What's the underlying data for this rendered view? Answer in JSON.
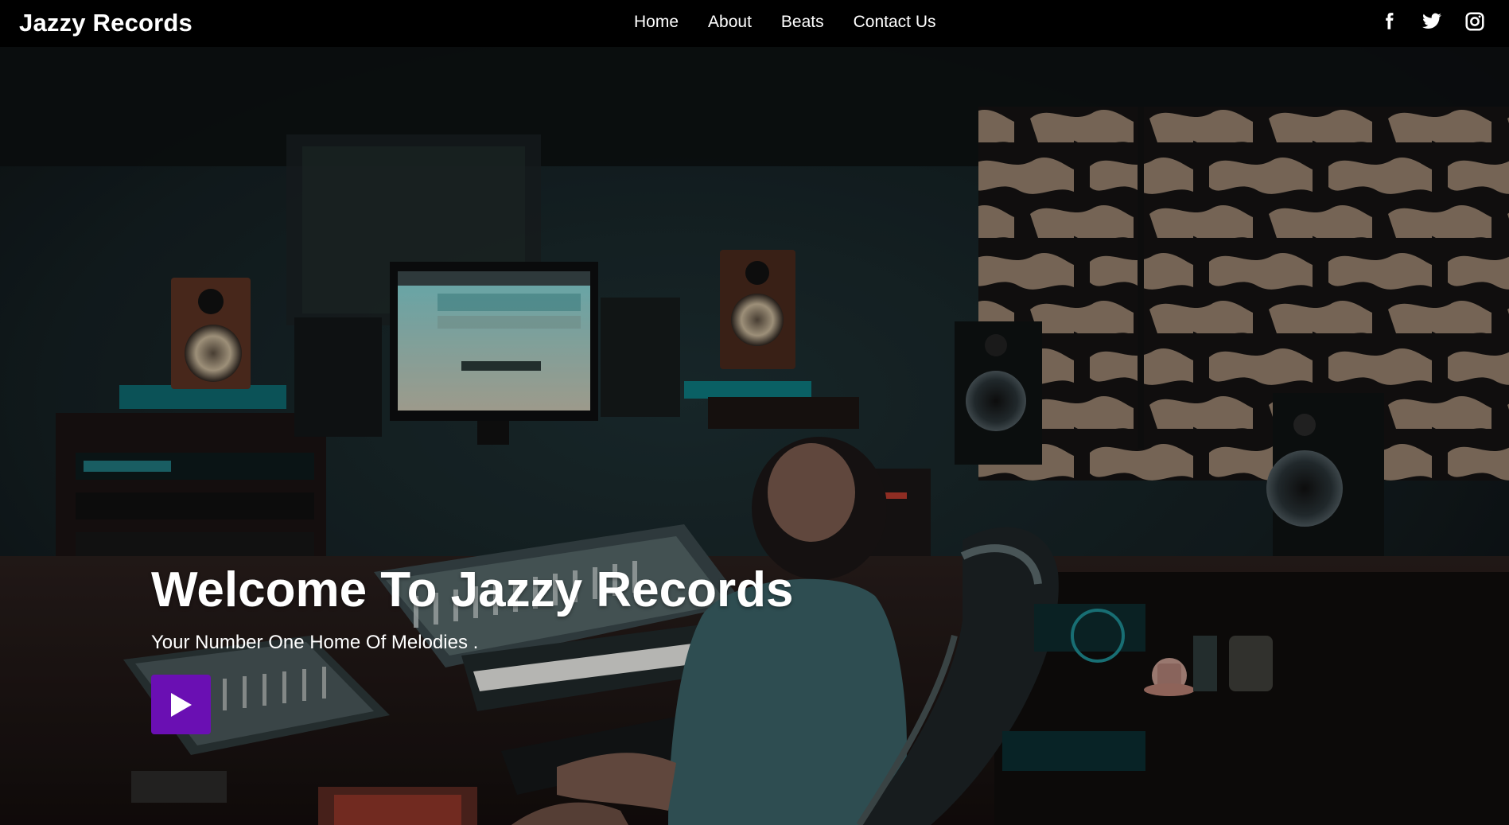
{
  "brand": {
    "name": "Jazzy Records"
  },
  "nav": {
    "items": [
      {
        "label": "Home"
      },
      {
        "label": "About"
      },
      {
        "label": "Beats"
      },
      {
        "label": "Contact Us"
      }
    ]
  },
  "social": {
    "icons": [
      "facebook-icon",
      "twitter-icon",
      "instagram-icon"
    ]
  },
  "hero": {
    "title": "Welcome To Jazzy Records",
    "subtitle": "Your Number One Home Of Melodies .",
    "play_icon": "play-icon",
    "accent_color": "#6a0fb3"
  },
  "colors": {
    "navbar_bg": "#000000",
    "text": "#ffffff"
  }
}
